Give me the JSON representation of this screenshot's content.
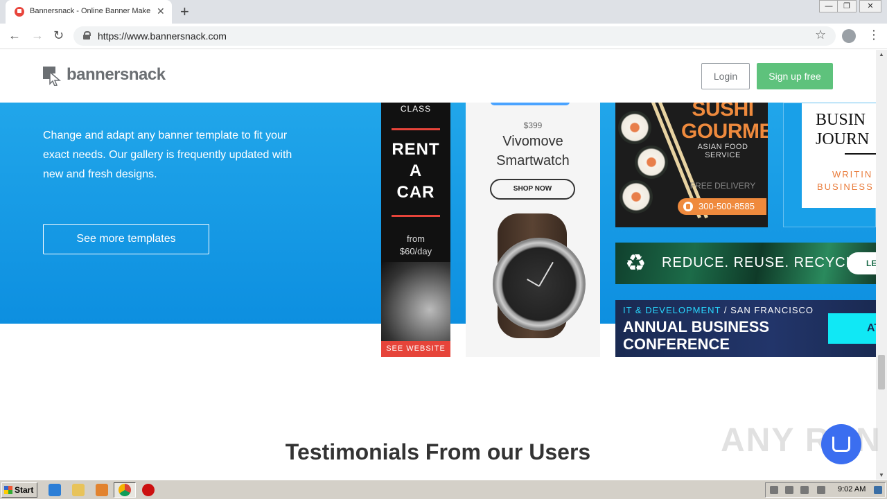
{
  "browser": {
    "tab_title": "Bannersnack - Online Banner Maker, ",
    "url": "https://www.bannersnack.com"
  },
  "header": {
    "logo_text": "bannersnack",
    "login_label": "Login",
    "signup_label": "Sign up free"
  },
  "hero": {
    "description": "Change and adapt any banner template to fit your exact needs. Our gallery is frequently updated with new and fresh designs.",
    "cta_label": "See more templates"
  },
  "banners": {
    "car": {
      "class_label": "CLASS",
      "title_1": "RENT",
      "title_2": "A",
      "title_3": "CAR",
      "price_1": "from",
      "price_2": "$60/day",
      "cta": "SEE WEBSITE"
    },
    "watch": {
      "price": "$399",
      "title_1": "Vivomove",
      "title_2": "Smartwatch",
      "cta": "SHOP NOW"
    },
    "sushi": {
      "title_1": "SUSHI",
      "title_2": "GOURMET",
      "subtitle": "ASIAN FOOD SERVICE",
      "delivery": "FREE DELIVERY",
      "phone": "300-500-8585"
    },
    "journal": {
      "title_1": "BUSIN",
      "title_2": "JOURN",
      "sub_1": "WRITIN",
      "sub_2": "BUSINESS"
    },
    "recycle": {
      "text": "REDUCE. REUSE. RECYCLE.",
      "cta": "LE"
    },
    "conference": {
      "category": "IT & DEVELOPMENT",
      "location": "/ SAN FRANCISCO",
      "title_1": "ANNUAL BUSINESS",
      "title_2": "CONFERENCE",
      "cta": "ATT"
    }
  },
  "testimonials_title": "Testimonials From our Users",
  "watermark": "ANY RUN",
  "taskbar": {
    "start_label": "Start",
    "clock": "9:02 AM"
  },
  "colors": {
    "hero_blue": "#139ae4",
    "signup_green": "#5ec27c",
    "car_red": "#e6443a",
    "sushi_orange": "#ef8a3d",
    "conference_cyan": "#10e8f5"
  }
}
